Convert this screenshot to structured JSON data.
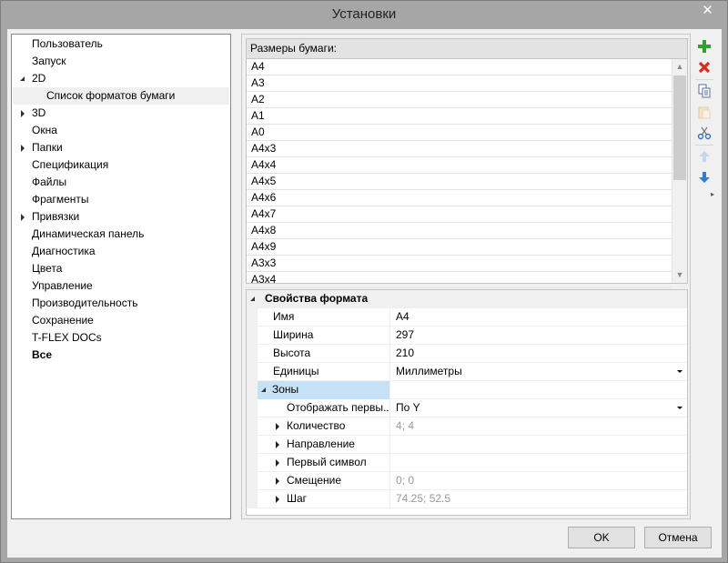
{
  "window": {
    "title": "Установки"
  },
  "tree": {
    "items": [
      {
        "label": "Пользователь",
        "expander": "none",
        "level": 0
      },
      {
        "label": "Запуск",
        "expander": "none",
        "level": 0
      },
      {
        "label": "2D",
        "expander": "open",
        "level": 0
      },
      {
        "label": "Список форматов бумаги",
        "expander": "none",
        "level": 1,
        "selected": true
      },
      {
        "label": "3D",
        "expander": "closed",
        "level": 0
      },
      {
        "label": "Окна",
        "expander": "none",
        "level": 0
      },
      {
        "label": "Папки",
        "expander": "closed",
        "level": 0
      },
      {
        "label": "Спецификация",
        "expander": "none",
        "level": 0
      },
      {
        "label": "Файлы",
        "expander": "none",
        "level": 0
      },
      {
        "label": "Фрагменты",
        "expander": "none",
        "level": 0
      },
      {
        "label": "Привязки",
        "expander": "closed",
        "level": 0
      },
      {
        "label": "Динамическая панель",
        "expander": "none",
        "level": 0
      },
      {
        "label": "Диагностика",
        "expander": "none",
        "level": 0
      },
      {
        "label": "Цвета",
        "expander": "none",
        "level": 0
      },
      {
        "label": "Управление",
        "expander": "none",
        "level": 0
      },
      {
        "label": "Производительность",
        "expander": "none",
        "level": 0
      },
      {
        "label": "Сохранение",
        "expander": "none",
        "level": 0
      },
      {
        "label": "T-FLEX DOCs",
        "expander": "none",
        "level": 0
      },
      {
        "label": "Все",
        "expander": "none",
        "level": 0,
        "bold": true
      }
    ]
  },
  "paper_list": {
    "header": "Размеры бумаги:",
    "items": [
      "A4",
      "A3",
      "A2",
      "A1",
      "A0",
      "A4x3",
      "A4x4",
      "A4x5",
      "A4x6",
      "A4x7",
      "A4x8",
      "A4x9",
      "A3x3",
      "A3x4"
    ]
  },
  "properties": {
    "category": "Свойства формата",
    "rows": [
      {
        "name": "Имя",
        "value": "A4",
        "dropdown": false,
        "grey": false,
        "expander": "none",
        "indent": 0
      },
      {
        "name": "Ширина",
        "value": "297",
        "dropdown": false,
        "grey": false,
        "expander": "none",
        "indent": 0
      },
      {
        "name": "Высота",
        "value": "210",
        "dropdown": false,
        "grey": false,
        "expander": "none",
        "indent": 0
      },
      {
        "name": "Единицы",
        "value": "Миллиметры",
        "dropdown": true,
        "grey": false,
        "expander": "none",
        "indent": 0
      },
      {
        "name": "Зоны",
        "value": "",
        "dropdown": false,
        "grey": false,
        "expander": "open",
        "indent": 0,
        "subcat": true
      },
      {
        "name": "Отображать первы...",
        "value": "По Y",
        "dropdown": true,
        "grey": false,
        "expander": "none",
        "indent": 1
      },
      {
        "name": "Количество",
        "value": "4; 4",
        "dropdown": false,
        "grey": true,
        "expander": "closed",
        "indent": 1
      },
      {
        "name": "Направление",
        "value": "",
        "dropdown": false,
        "grey": false,
        "expander": "closed",
        "indent": 1
      },
      {
        "name": "Первый символ",
        "value": "",
        "dropdown": false,
        "grey": false,
        "expander": "closed",
        "indent": 1
      },
      {
        "name": "Смещение",
        "value": "0; 0",
        "dropdown": false,
        "grey": true,
        "expander": "closed",
        "indent": 1
      },
      {
        "name": "Шаг",
        "value": "74.25; 52.5",
        "dropdown": false,
        "grey": true,
        "expander": "closed",
        "indent": 1
      }
    ]
  },
  "toolbar": {
    "icons": [
      "add-icon",
      "delete-icon",
      "copy-icon",
      "paste-icon",
      "cut-icon",
      "move-up-icon",
      "move-down-icon"
    ]
  },
  "buttons": {
    "ok": "OK",
    "cancel": "Отмена"
  }
}
